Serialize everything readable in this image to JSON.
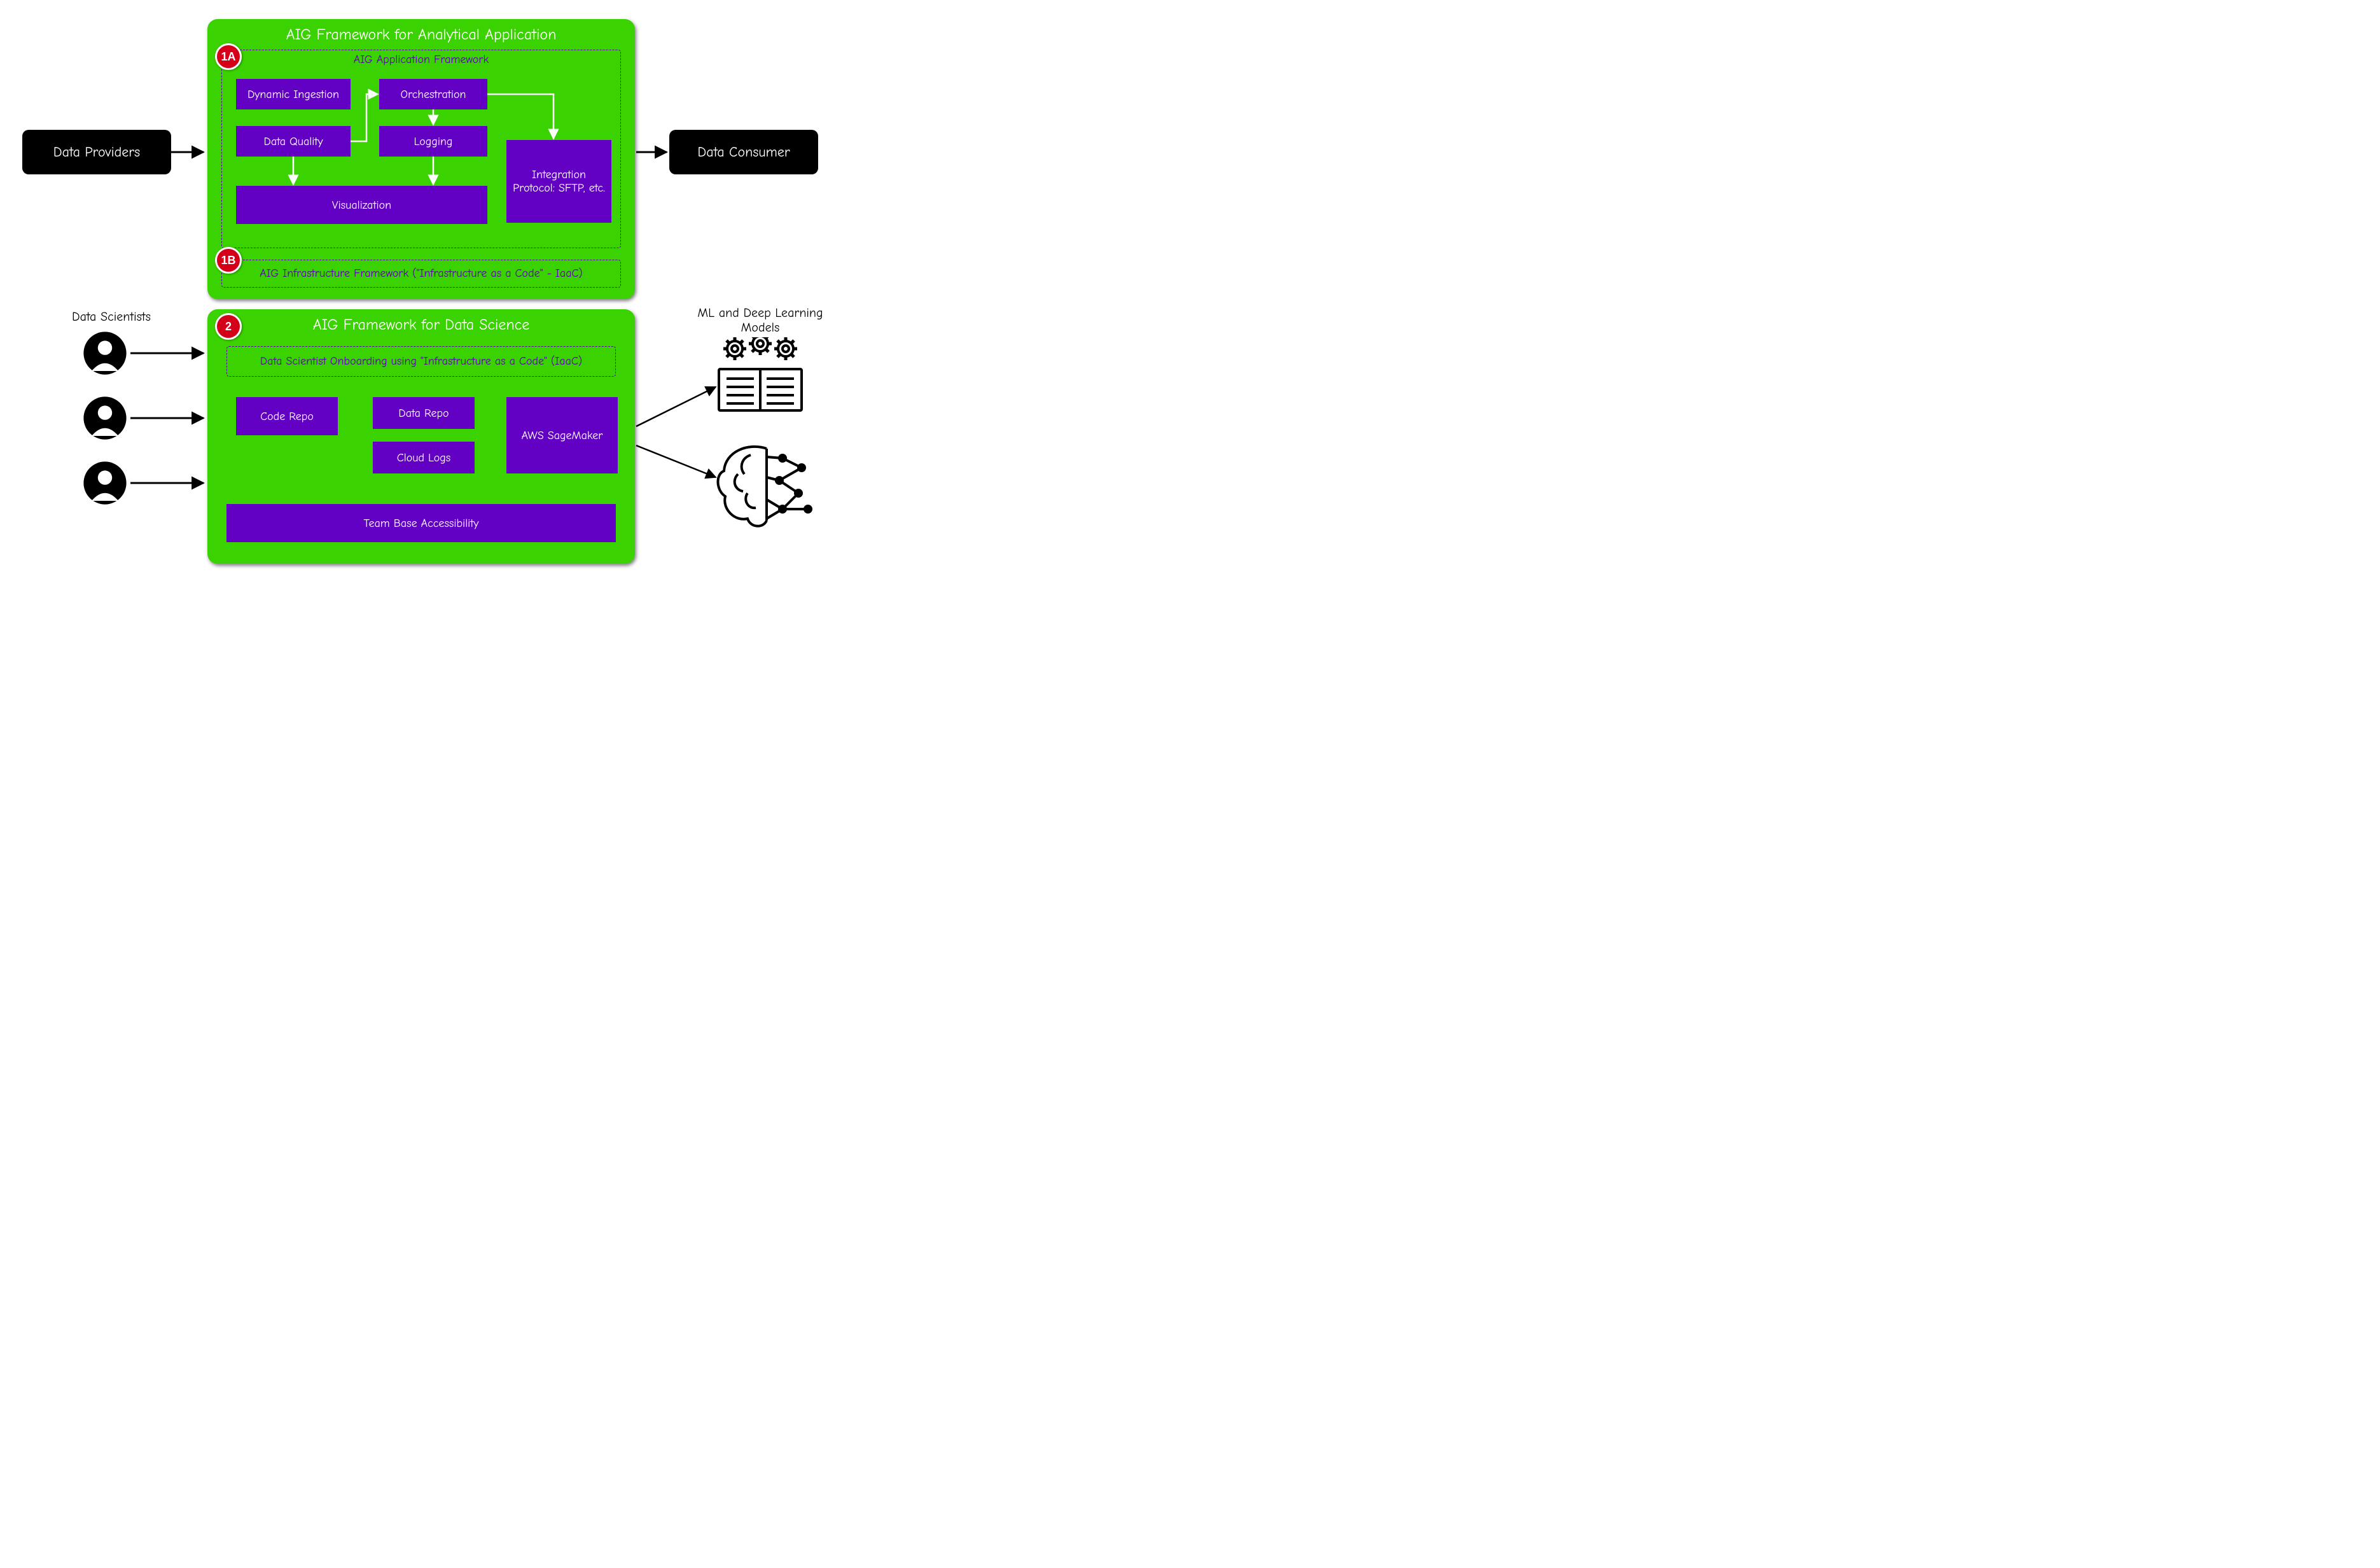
{
  "left": {
    "data_providers": "Data Providers",
    "data_scientists_label": "Data Scientists"
  },
  "right": {
    "data_consumer": "Data Consumer",
    "ml_models_label": "ML and Deep Learning Models"
  },
  "panel1": {
    "title": "AIG Framework for Analytical Application",
    "badge_1a": "1A",
    "badge_1b": "1B",
    "frame_app_title": "AIG Application Framework",
    "frame_infra_title": "AIG Infrastructure Framework  (\"Infrastructure as a Code\" - IaaC)",
    "boxes": {
      "dynamic_ingestion": "Dynamic Ingestion",
      "data_quality": "Data Quality",
      "orchestration": "Orchestration",
      "logging": "Logging",
      "visualization": "Visualization",
      "integration_protocol": "Integration Protocol: SFTP, etc."
    }
  },
  "panel2": {
    "title": "AIG Framework for Data Science",
    "badge_2": "2",
    "frame_onboarding_title": "Data Scientist Onboarding using \"Infrastructure as a Code\" (IaaC)",
    "boxes": {
      "code_repo": "Code Repo",
      "data_repo": "Data Repo",
      "cloud_logs": "Cloud Logs",
      "aws_sagemaker": "AWS SageMaker",
      "team_base": "Team Base Accessibility"
    }
  },
  "colors": {
    "green": "#3ad200",
    "purple": "#6200c4",
    "purple_text": "#5a00b3",
    "badge_red": "#d4001a",
    "black": "#000000"
  }
}
